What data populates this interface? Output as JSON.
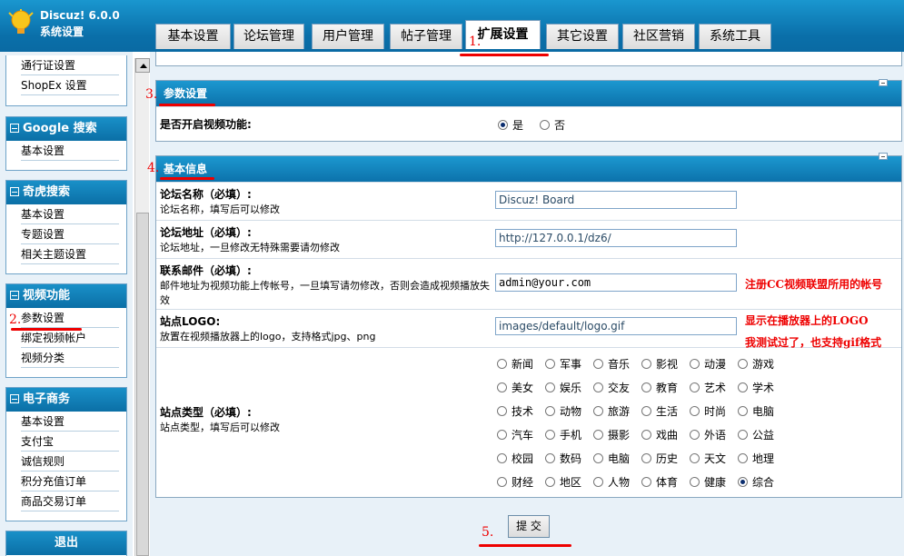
{
  "app": {
    "name": "Discuz! 6.0.0",
    "subtitle": "系统设置",
    "logo_icon": "lightbulb-icon"
  },
  "tabs": [
    {
      "label": "基本设置"
    },
    {
      "label": "论坛管理"
    },
    {
      "label": "用户管理"
    },
    {
      "label": "帖子管理"
    },
    {
      "label": "扩展设置",
      "active": true
    },
    {
      "label": "其它设置"
    },
    {
      "label": "社区营销"
    },
    {
      "label": "系统工具"
    }
  ],
  "sidebar": {
    "top_links": [
      "通行证设置",
      "ShopEx 设置"
    ],
    "boxes": [
      {
        "title": "Google 搜索",
        "links": [
          "基本设置"
        ]
      },
      {
        "title": "奇虎搜索",
        "links": [
          "基本设置",
          "专题设置",
          "相关主题设置"
        ]
      },
      {
        "title": "视频功能",
        "links": [
          "参数设置",
          "绑定视频帐户",
          "视频分类"
        ]
      },
      {
        "title": "电子商务",
        "links": [
          "基本设置",
          "支付宝",
          "诚信规则",
          "积分充值订单",
          "商品交易订单"
        ]
      }
    ],
    "logout": "退出"
  },
  "params_panel": {
    "title": "参数设置",
    "video_label": "是否开启视频功能:",
    "yes": "是",
    "no": "否",
    "video_enabled": true
  },
  "info_panel": {
    "title": "基本信息",
    "forum_name": {
      "title": "论坛名称（必填）:",
      "desc": "论坛名称，填写后可以修改",
      "value": "Discuz! Board"
    },
    "forum_url": {
      "title": "论坛地址（必填）:",
      "desc": "论坛地址，一旦修改无特殊需要请勿修改",
      "value": "http://127.0.0.1/dz6/"
    },
    "email": {
      "title": "联系邮件（必填）:",
      "desc": "邮件地址为视频功能上传帐号，一旦填写请勿修改，否则会造成视频播放失效",
      "value": "admin@your.com"
    },
    "logo": {
      "title": "站点LOGO:",
      "desc": "放置在视频播放器上的logo，支持格式jpg、png",
      "value": "images/default/logo.gif"
    },
    "site_type": {
      "title": "站点类型（必填）:",
      "desc": "站点类型，填写后可以修改",
      "options": [
        "新闻",
        "军事",
        "音乐",
        "影视",
        "动漫",
        "游戏",
        "美女",
        "娱乐",
        "交友",
        "教育",
        "艺术",
        "学术",
        "技术",
        "动物",
        "旅游",
        "生活",
        "时尚",
        "电脑",
        "汽车",
        "手机",
        "摄影",
        "戏曲",
        "外语",
        "公益",
        "校园",
        "数码",
        "电脑",
        "历史",
        "天文",
        "地理",
        "财经",
        "地区",
        "人物",
        "体育",
        "健康",
        "综合"
      ],
      "selected": "综合"
    }
  },
  "submit_label": "提 交",
  "annotations": {
    "a1": "1.",
    "a2": "2.",
    "a3": "3.",
    "a4": "4.",
    "a5": "5."
  },
  "notes": {
    "email_note": "注册CC视频联盟所用的帐号",
    "logo_note1": "显示在播放器上的LOGO",
    "logo_note2": "我测试过了，也支持gif格式"
  },
  "colors": {
    "header": "#0a6fa9",
    "accent_red": "#e00000",
    "panel_border": "#8aa8c0"
  }
}
